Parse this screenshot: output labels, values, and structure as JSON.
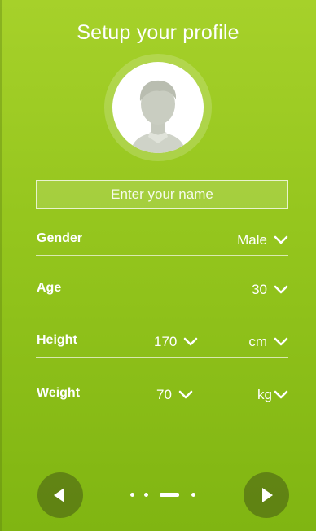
{
  "screen": {
    "title": "Setup your profile"
  },
  "avatar": {
    "icon": "user-silhouette-icon"
  },
  "name": {
    "placeholder": "Enter your name",
    "value": ""
  },
  "fields": {
    "gender": {
      "label": "Gender",
      "value": "Male"
    },
    "age": {
      "label": "Age",
      "value": "30"
    },
    "height": {
      "label": "Height",
      "value": "170",
      "unit": "cm"
    },
    "weight": {
      "label": "Weight",
      "value": "70",
      "unit": "kg"
    }
  },
  "pager": {
    "pages": 4,
    "current": 3
  },
  "icons": {
    "prev": "chevron-left-play-icon",
    "next": "chevron-right-play-icon",
    "dropdown": "chevron-down-icon"
  },
  "colors": {
    "background_top": "#a6d12a",
    "background_bottom": "#80b512",
    "text": "#ffffff"
  }
}
